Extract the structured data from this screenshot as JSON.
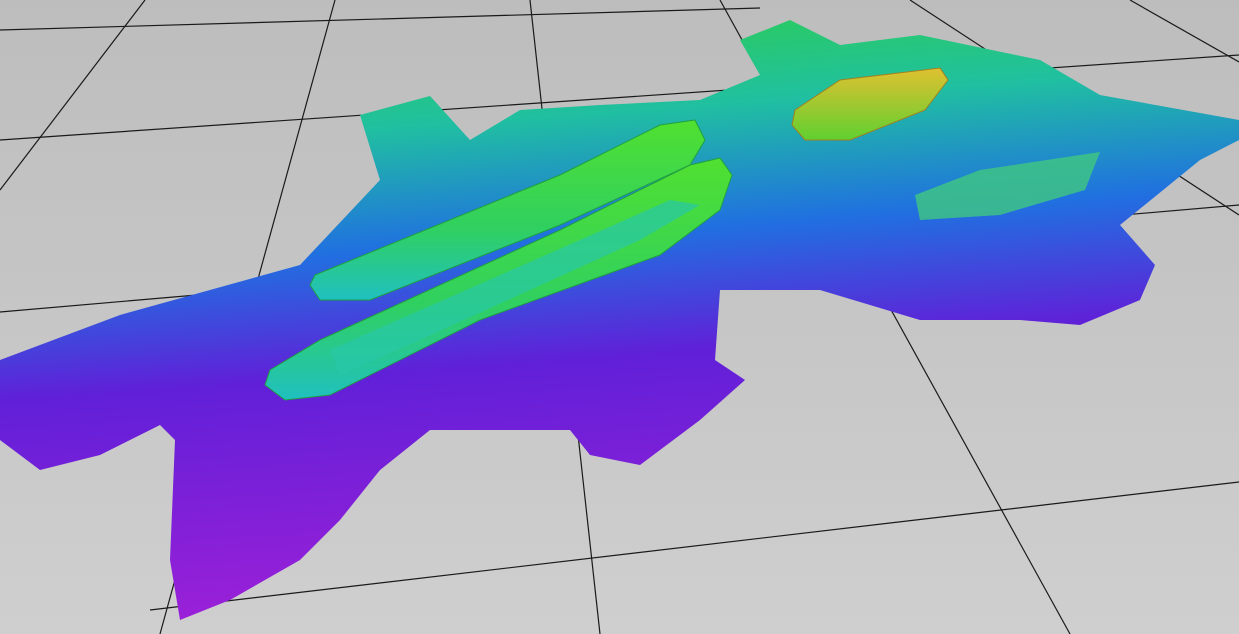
{
  "viewport": {
    "background_color": "#c8c8c8",
    "grid_color": "#1a1a1a",
    "colormap": [
      "#e8c020",
      "#30d030",
      "#20c0c0",
      "#2060e0",
      "#7010d0",
      "#9020d0"
    ]
  }
}
